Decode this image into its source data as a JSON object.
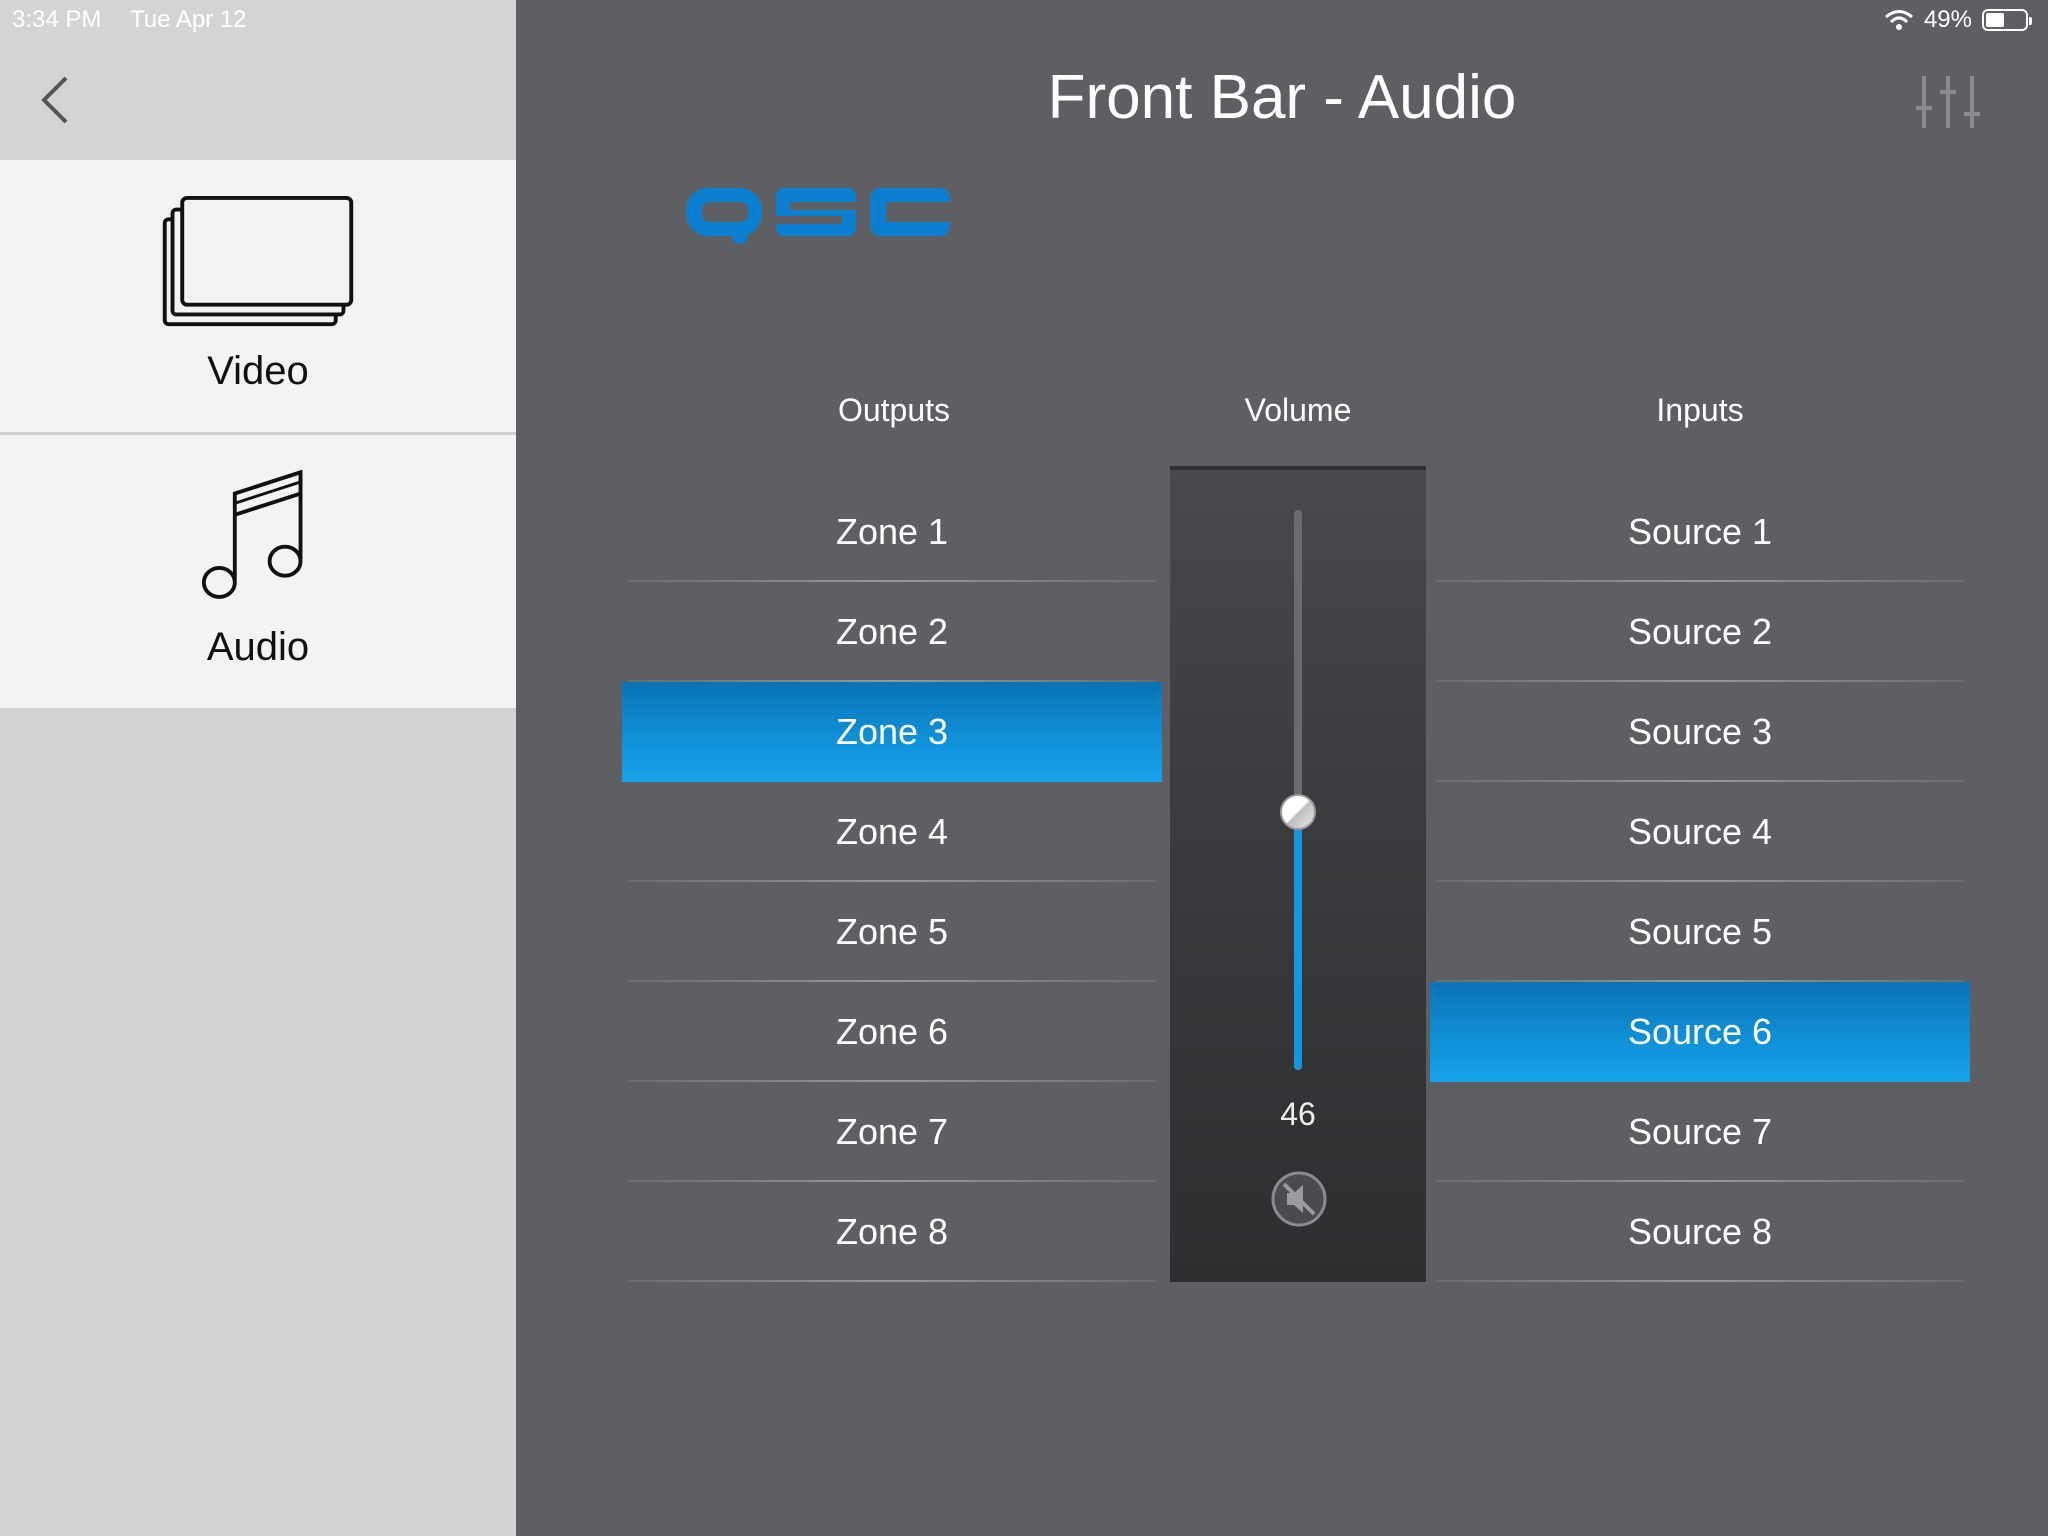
{
  "status_bar": {
    "time": "3:34 PM",
    "date": "Tue Apr 12",
    "battery": "49%"
  },
  "sidebar": {
    "items": [
      {
        "label": "Video",
        "icon": "video-stack-icon",
        "active": false
      },
      {
        "label": "Audio",
        "icon": "music-note-icon",
        "active": true
      }
    ]
  },
  "header": {
    "title": "Front Bar - Audio"
  },
  "brand": {
    "logo_text": "QSC",
    "color": "#0a7fd0"
  },
  "columns": {
    "outputs": "Outputs",
    "volume": "Volume",
    "inputs": "Inputs"
  },
  "outputs": [
    {
      "label": "Zone 1",
      "selected": false
    },
    {
      "label": "Zone 2",
      "selected": false
    },
    {
      "label": "Zone 3",
      "selected": true
    },
    {
      "label": "Zone 4",
      "selected": false
    },
    {
      "label": "Zone 5",
      "selected": false
    },
    {
      "label": "Zone 6",
      "selected": false
    },
    {
      "label": "Zone 7",
      "selected": false
    },
    {
      "label": "Zone 8",
      "selected": false
    }
  ],
  "inputs": [
    {
      "label": "Source 1",
      "selected": false
    },
    {
      "label": "Source 2",
      "selected": false
    },
    {
      "label": "Source 3",
      "selected": false
    },
    {
      "label": "Source 4",
      "selected": false
    },
    {
      "label": "Source 5",
      "selected": false
    },
    {
      "label": "Source 6",
      "selected": true
    },
    {
      "label": "Source 7",
      "selected": false
    },
    {
      "label": "Source 8",
      "selected": false
    }
  ],
  "volume": {
    "value": "46",
    "level": 0.46,
    "muted": false
  },
  "colors": {
    "accent": "#1597e0",
    "background": "#5e5f62"
  }
}
